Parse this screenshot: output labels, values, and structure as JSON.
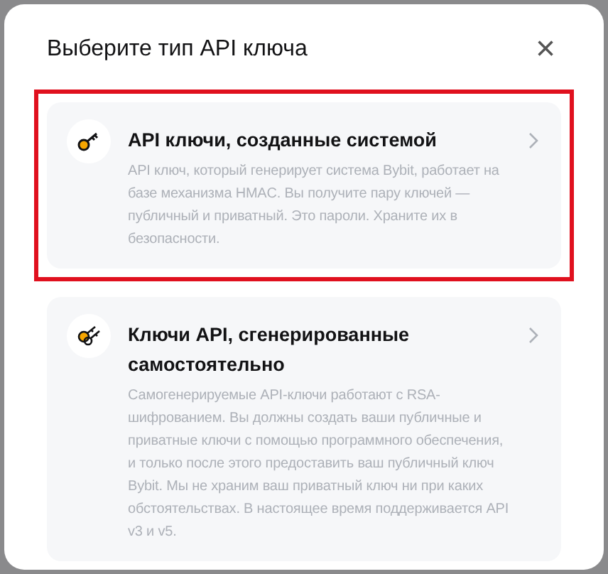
{
  "dialog": {
    "title": "Выберите тип API ключа",
    "close": "×"
  },
  "options": [
    {
      "kind": "system",
      "title": "API ключи, созданные системой",
      "description": "API ключ, который генерирует система Bybit, работает на базе механизма HMAC. Вы получите пару ключей — публичный и приватный. Это пароли. Храните их в безопасности.",
      "highlighted": true
    },
    {
      "kind": "self",
      "title": "Ключи API, сгенерированные самостоятельно",
      "description": "Самогенерируемые API-ключи работают с RSA-шифрованием. Вы должны создать ваши публичные и приватные ключи с помощью программного обеспечения, и только после этого предоставить ваш публичный ключ Bybit. Мы не храним ваш приватный ключ ни при каких обстоятельствах. В настоящее время поддерживается API v3 и v5.",
      "highlighted": false
    }
  ]
}
